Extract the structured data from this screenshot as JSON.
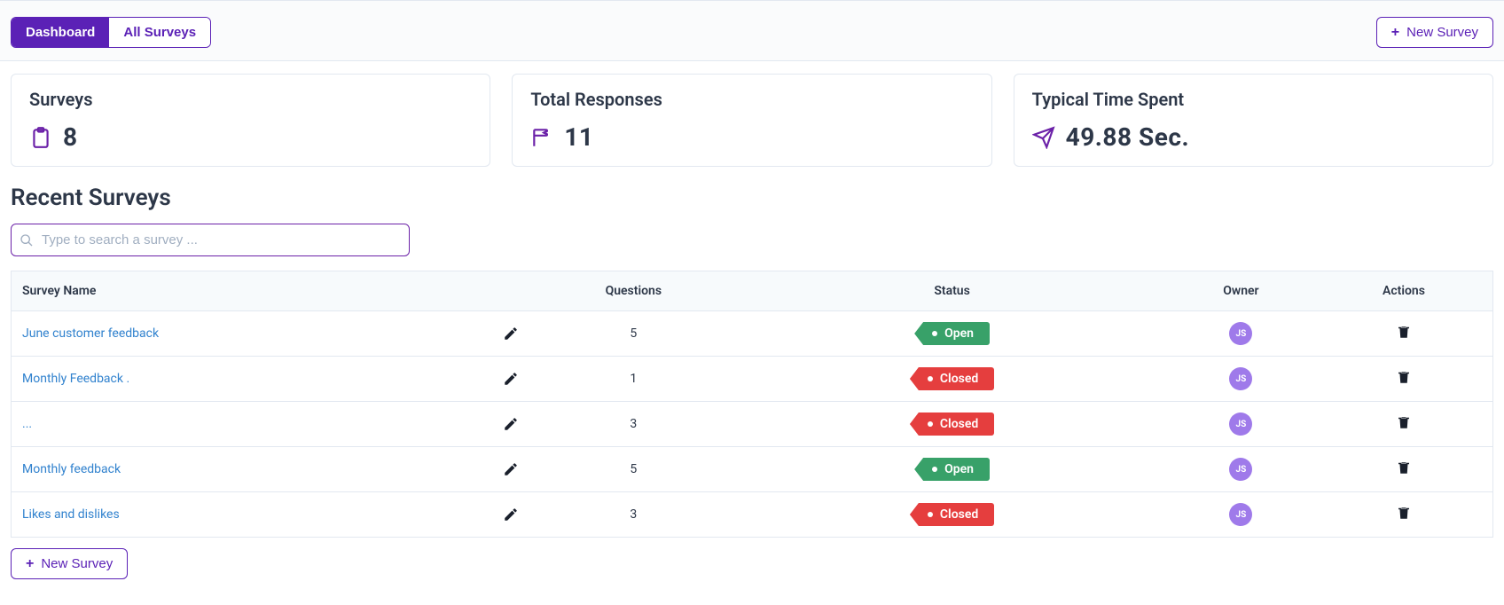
{
  "tabs": {
    "dashboard": "Dashboard",
    "all_surveys": "All Surveys"
  },
  "buttons": {
    "new_survey": "New Survey"
  },
  "stats": {
    "surveys": {
      "title": "Surveys",
      "value": "8"
    },
    "responses": {
      "title": "Total Responses",
      "value": "11"
    },
    "time": {
      "title": "Typical Time Spent",
      "value": "49.88 Sec."
    }
  },
  "section_title": "Recent Surveys",
  "search": {
    "placeholder": "Type to search a survey ..."
  },
  "table": {
    "headers": {
      "name": "Survey Name",
      "questions": "Questions",
      "status": "Status",
      "owner": "Owner",
      "actions": "Actions"
    },
    "rows": [
      {
        "name": "June customer feedback",
        "questions": "5",
        "status": "Open",
        "status_class": "open",
        "owner": "JS"
      },
      {
        "name": "Monthly Feedback .",
        "questions": "1",
        "status": "Closed",
        "status_class": "closed",
        "owner": "JS"
      },
      {
        "name": "...",
        "questions": "3",
        "status": "Closed",
        "status_class": "closed",
        "owner": "JS"
      },
      {
        "name": "Monthly feedback",
        "questions": "5",
        "status": "Open",
        "status_class": "open",
        "owner": "JS"
      },
      {
        "name": "Likes and dislikes",
        "questions": "3",
        "status": "Closed",
        "status_class": "closed",
        "owner": "JS"
      }
    ]
  }
}
